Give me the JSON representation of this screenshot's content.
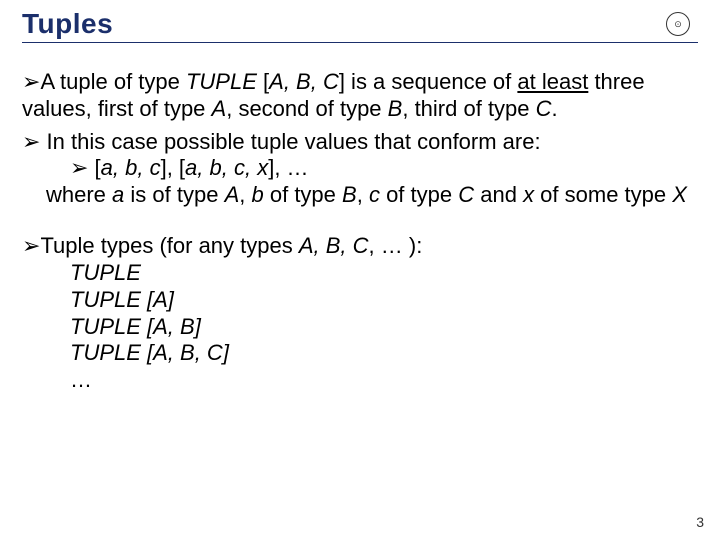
{
  "title": "Tuples",
  "logo_label": "⊙",
  "p1_a": "A tuple of type ",
  "p1_b": "TUPLE",
  "p1_c": " [",
  "p1_d": "A, B, C",
  "p1_e": "] is a sequence of ",
  "p1_f": "at least",
  "p1_g": " three values, first of type ",
  "p1_h": "A",
  "p1_i": ", second of type ",
  "p1_j": "B",
  "p1_k": ", third of type ",
  "p1_l": "C",
  "p1_m": ".",
  "p2": " In this case possible tuple values that conform are:",
  "p3_a": " [",
  "p3_b": "a, b, c",
  "p3_c": "], [",
  "p3_d": "a, b, c, x",
  "p3_e": "], …",
  "p4_a": "where ",
  "p4_b": "a",
  "p4_c": " is of type ",
  "p4_d": "A",
  "p4_e": ", ",
  "p4_f": "b",
  "p4_g": " of type ",
  "p4_h": "B",
  "p4_i": ", ",
  "p4_j": "c",
  "p4_k": " of type ",
  "p4_l": "C",
  "p4_m": " and ",
  "p4_n": "x",
  "p4_o": " of some type ",
  "p4_p": "X",
  "p5_a": "Tuple types (for any types ",
  "p5_b": "A, B, C",
  "p5_c": ", … ):",
  "t1": "TUPLE",
  "t2": "TUPLE [A]",
  "t3": "TUPLE [A, B]",
  "t4": "TUPLE [A, B, C]",
  "t5": "…",
  "page_number": "3",
  "bullet": "➢"
}
